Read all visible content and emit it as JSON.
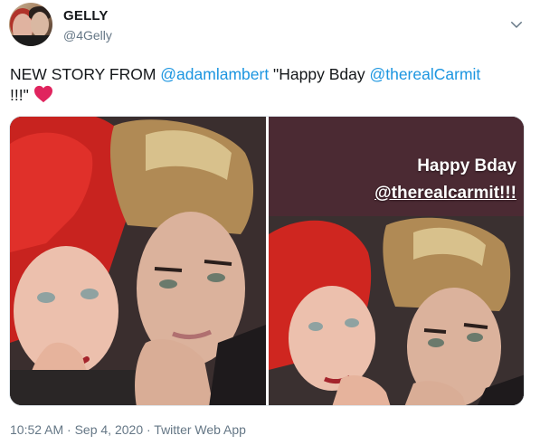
{
  "user": {
    "display_name": "GELLY",
    "handle": "@4Gelly",
    "avatar_icon": "user-avatar"
  },
  "tweet": {
    "text_prefix": "NEW STORY FROM ",
    "mention_1": "@adamlambert",
    "text_middle": " \"Happy Bday ",
    "mention_2": "@therealCarmit",
    "text_suffix": " !!!\"",
    "emoji": "red-heart-icon",
    "timestamp": "10:52 AM · Sep 4, 2020 · Twitter Web App"
  },
  "media": {
    "overlay_line_1": "Happy Bday",
    "overlay_line_2": "@therealcarmit!!!"
  },
  "colors": {
    "link": "#1b95e0",
    "secondary_text": "#657786",
    "heart": "#e0245e"
  }
}
